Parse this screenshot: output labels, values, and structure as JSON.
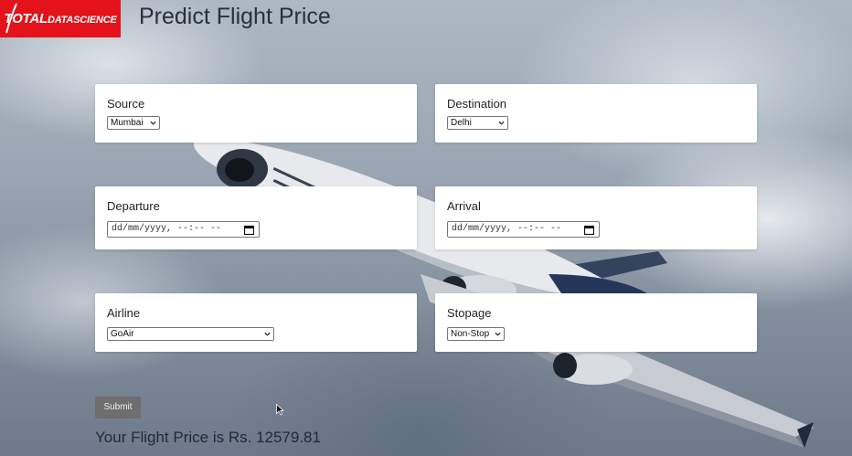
{
  "header": {
    "logo_brand_main": "TOTAL",
    "logo_brand_sub": "DATASCIENCE",
    "title": "Predict Flight Price"
  },
  "form": {
    "source": {
      "label": "Source",
      "value": "Mumbai"
    },
    "destination": {
      "label": "Destination",
      "value": "Delhi"
    },
    "departure": {
      "label": "Departure",
      "value": "dd/mm/yyyy, --:-- --"
    },
    "arrival": {
      "label": "Arrival",
      "value": "dd/mm/yyyy, --:-- --"
    },
    "airline": {
      "label": "Airline",
      "value": "GoAir"
    },
    "stopage": {
      "label": "Stopage",
      "value": "Non-Stop"
    },
    "submit_label": "Submit"
  },
  "result": {
    "text": "Your Flight Price is Rs. 12579.81"
  },
  "colors": {
    "logo_red": "#e3121b",
    "card_bg": "#ffffff",
    "submit_bg": "#6e6e6e",
    "title_text": "#27303b"
  },
  "icons": {
    "select_chevron": "chevron-down-icon",
    "datetime_picker": "calendar-icon",
    "pointer": "cursor-icon",
    "logo": "swoosh-icon"
  }
}
